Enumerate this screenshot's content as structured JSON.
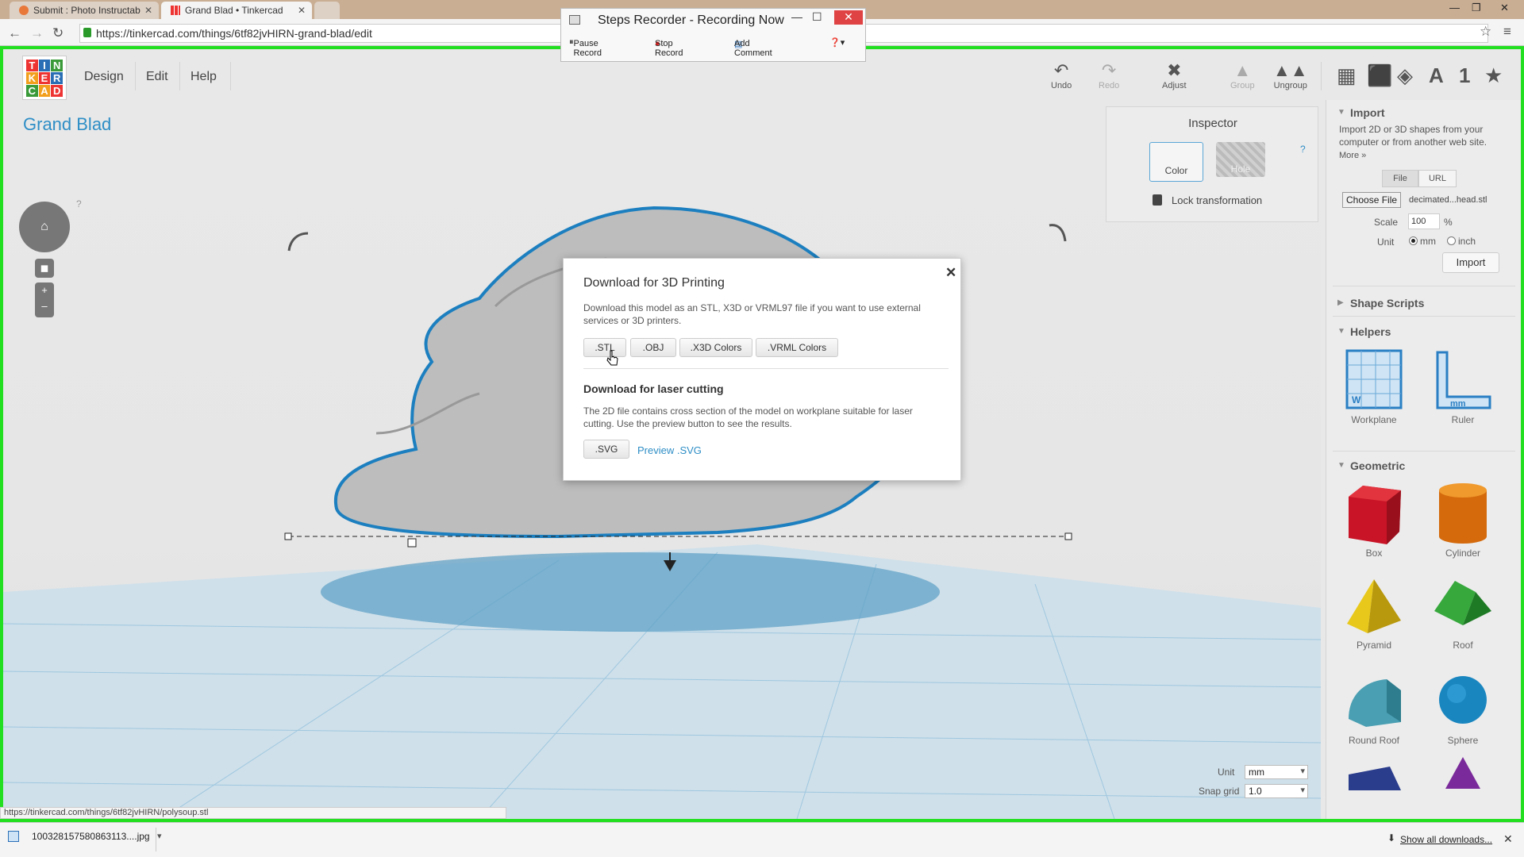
{
  "browser": {
    "tabs": [
      {
        "title": "Submit : Photo Instructab"
      },
      {
        "title": "Grand Blad • Tinkercad"
      }
    ],
    "url": "https://tinkercad.com/things/6tf82jvHIRN-grand-blad/edit",
    "status_url": "https://tinkercad.com/things/6tf82jvHIRN/polysoup.stl"
  },
  "steps_recorder": {
    "title": "Steps Recorder - Recording Now",
    "pause": "Pause Record",
    "stop": "Stop Record",
    "comment": "Add Comment"
  },
  "app": {
    "logo": [
      "T",
      "I",
      "N",
      "K",
      "E",
      "R",
      "C",
      "A",
      "D"
    ],
    "menu": {
      "design": "Design",
      "edit": "Edit",
      "help": "Help"
    },
    "toolbar": {
      "undo": "Undo",
      "redo": "Redo",
      "adjust": "Adjust",
      "group": "Group",
      "ungroup": "Ungroup"
    },
    "design_title": "Grand Blad",
    "help_mark": "?"
  },
  "inspector": {
    "title": "Inspector",
    "color": "Color",
    "hole": "Hole",
    "help": "?",
    "lock": "Lock transformation"
  },
  "panel": {
    "import": {
      "heading": "Import",
      "desc": "Import 2D or 3D shapes from your computer or from another web site.",
      "more": "More »",
      "file_tab": "File",
      "url_tab": "URL",
      "choose_file": "Choose File",
      "filename": "decimated...head.stl",
      "scale_label": "Scale",
      "scale_value": "100",
      "percent": "%",
      "unit_label": "Unit",
      "mm": "mm",
      "inch": "inch",
      "import_btn": "Import"
    },
    "shape_scripts": "Shape Scripts",
    "helpers": {
      "heading": "Helpers",
      "workplane": "Workplane",
      "ruler": "Ruler",
      "wp_mark": "W",
      "ruler_mark": "mm"
    },
    "geometric": {
      "heading": "Geometric",
      "box": "Box",
      "cylinder": "Cylinder",
      "pyramid": "Pyramid",
      "roof": "Roof",
      "round_roof": "Round Roof",
      "sphere": "Sphere"
    }
  },
  "grid_controls": {
    "unit_label": "Unit",
    "unit_value": "mm",
    "snap_label": "Snap grid",
    "snap_value": "1.0"
  },
  "modal": {
    "title": "Download for 3D Printing",
    "text1": "Download this model as an STL, X3D or VRML97 file if you want to use external services or 3D printers.",
    "btn_stl": ".STL",
    "btn_obj": ".OBJ",
    "btn_x3d": ".X3D Colors",
    "btn_vrml": ".VRML Colors",
    "laser_title": "Download for laser cutting",
    "text2": "The 2D file contains cross section of the model on workplane suitable for laser cutting. Use the preview button to see the results.",
    "btn_svg": ".SVG",
    "preview": "Preview .SVG"
  },
  "downloads": {
    "file": "1003281575808631​13....jpg",
    "show_all": "Show all downloads..."
  }
}
